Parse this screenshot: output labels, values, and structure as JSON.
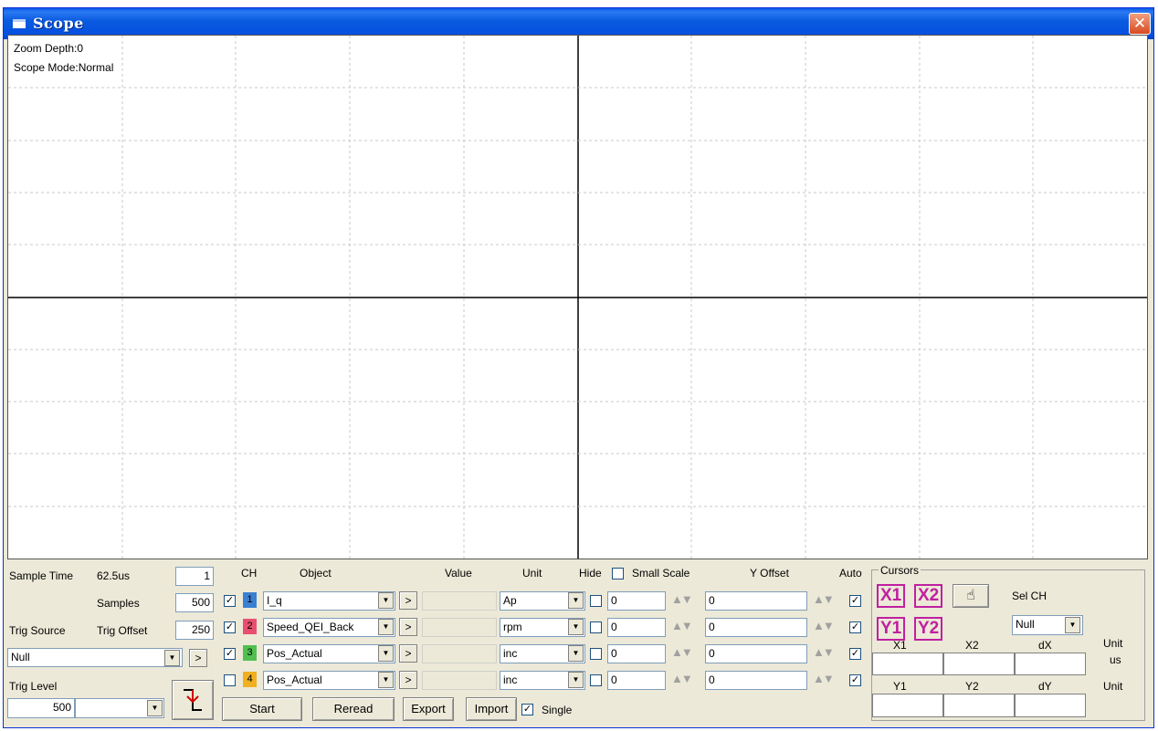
{
  "window": {
    "title": "Scope",
    "close_label": "✕"
  },
  "plot": {
    "zoom_depth": "Zoom Depth:0",
    "scope_mode": "Scope Mode:Normal"
  },
  "controls": {
    "sample_time_label": "Sample Time",
    "sample_time_value": "62.5us",
    "sample_time_input": "1",
    "samples_label": "Samples",
    "samples_value": "500",
    "trig_source_label": "Trig Source",
    "trig_offset_label": "Trig Offset",
    "trig_offset_value": "250",
    "trig_source_select": "Null",
    "trig_level_label": "Trig Level",
    "trig_level_value": "500",
    "go_arrow": ">"
  },
  "columns": {
    "ch": "CH",
    "object": "Object",
    "value": "Value",
    "unit": "Unit",
    "hide": "Hide",
    "small_scale": "Small Scale",
    "y_offset": "Y Offset",
    "auto": "Auto"
  },
  "channels": [
    {
      "checked": "✓",
      "num": "1",
      "color": "#3a7fd0",
      "object": "I_q",
      "unit": "Ap",
      "scale": "0",
      "offset": "0",
      "auto": "✓"
    },
    {
      "checked": "✓",
      "num": "2",
      "color": "#e85070",
      "object": "Speed_QEI_Back",
      "unit": "rpm",
      "scale": "0",
      "offset": "0",
      "auto": "✓"
    },
    {
      "checked": "✓",
      "num": "3",
      "color": "#50c050",
      "object": "Pos_Actual",
      "unit": "inc",
      "scale": "0",
      "offset": "0",
      "auto": "✓"
    },
    {
      "checked": "",
      "num": "4",
      "color": "#f0b020",
      "object": "Pos_Actual",
      "unit": "inc",
      "scale": "0",
      "offset": "0",
      "auto": "✓"
    }
  ],
  "buttons": {
    "start": "Start",
    "reread": "Reread",
    "export": "Export",
    "import": "Import",
    "single": "Single",
    "single_checked": "✓"
  },
  "cursors": {
    "title": "Cursors",
    "x1": "X1",
    "x2": "X2",
    "y1": "Y1",
    "y2": "Y2",
    "sel_ch_label": "Sel CH",
    "sel_ch_value": "Null",
    "x_headers": [
      "X1",
      "X2",
      "dX"
    ],
    "x_unit_label": "Unit",
    "x_unit": "us",
    "y_headers": [
      "Y1",
      "Y2",
      "dY"
    ],
    "y_unit_label": "Unit"
  }
}
